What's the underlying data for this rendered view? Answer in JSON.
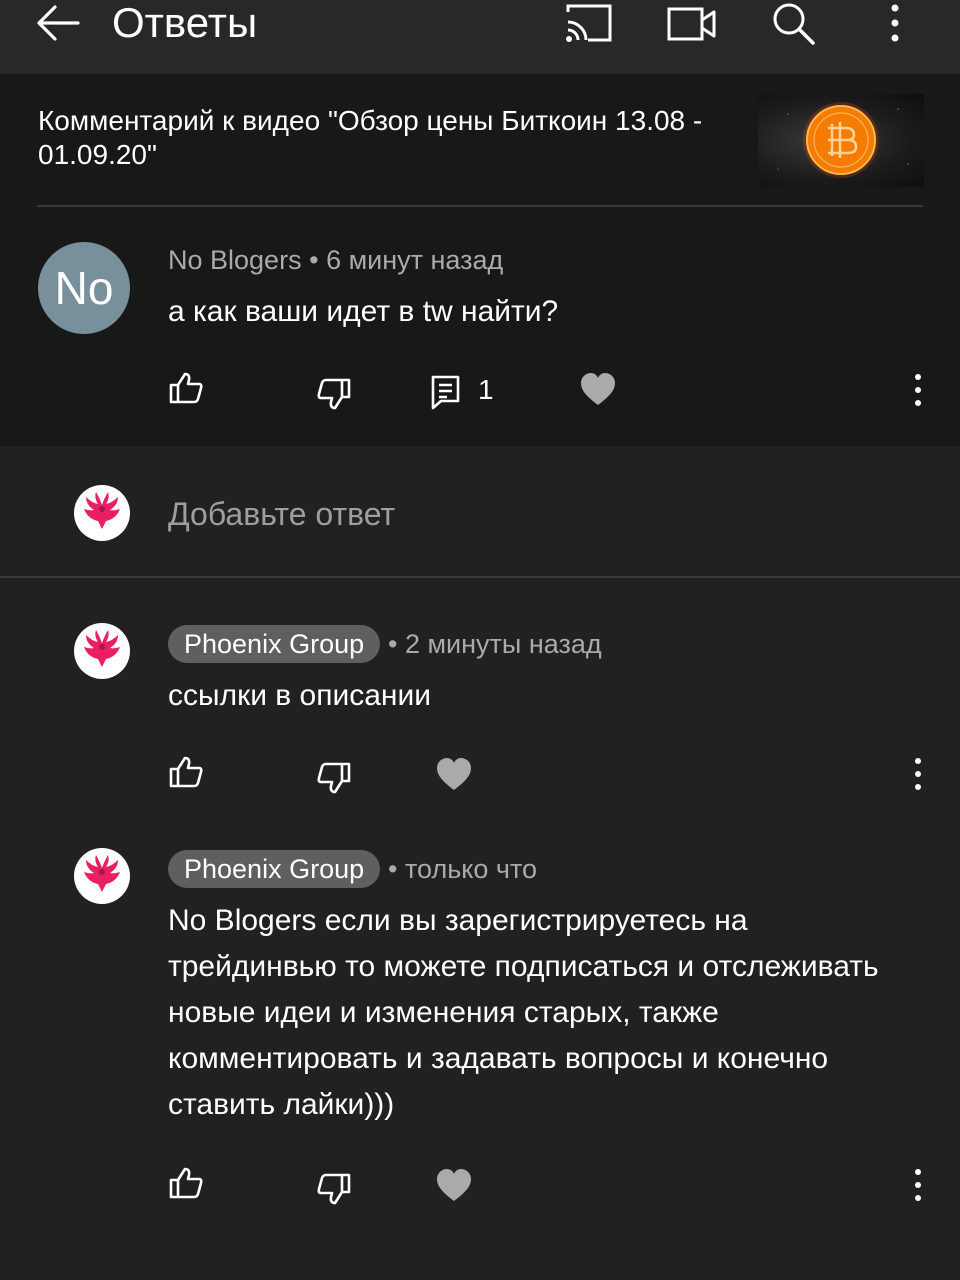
{
  "header": {
    "title": "Ответы",
    "icons": [
      "back-arrow-icon",
      "cast-icon",
      "video-camera-icon",
      "search-icon",
      "more-vert-icon"
    ]
  },
  "video": {
    "context": "Комментарий к видео \"Обзор цены Биткоин 13.08 - 01.09.20\""
  },
  "comment": {
    "avatar_text": "No",
    "author": "No Blogers",
    "time": "6 минут назад",
    "text": "а как ваши идет в tw  найти?",
    "reply_count": "1"
  },
  "reply_box": {
    "placeholder": "Добавьте ответ"
  },
  "replies": [
    {
      "author": "Phoenix Group",
      "time": "2 минуты назад",
      "text": "ссылки в описании"
    },
    {
      "author": "Phoenix Group",
      "time": "только что",
      "text": "No Blogers если вы зарегистрируетесь на трейдинвью то можете подписаться и отслеживать новые идеи и изменения старых, также комментировать и задавать вопросы и конечно ставить лайки)))"
    }
  ],
  "colors": {
    "background": "#212121",
    "header_background": "#181818",
    "badge": "#5f5f5f",
    "secondary_text": "#aaaaaa",
    "avatar": "#78909c"
  }
}
